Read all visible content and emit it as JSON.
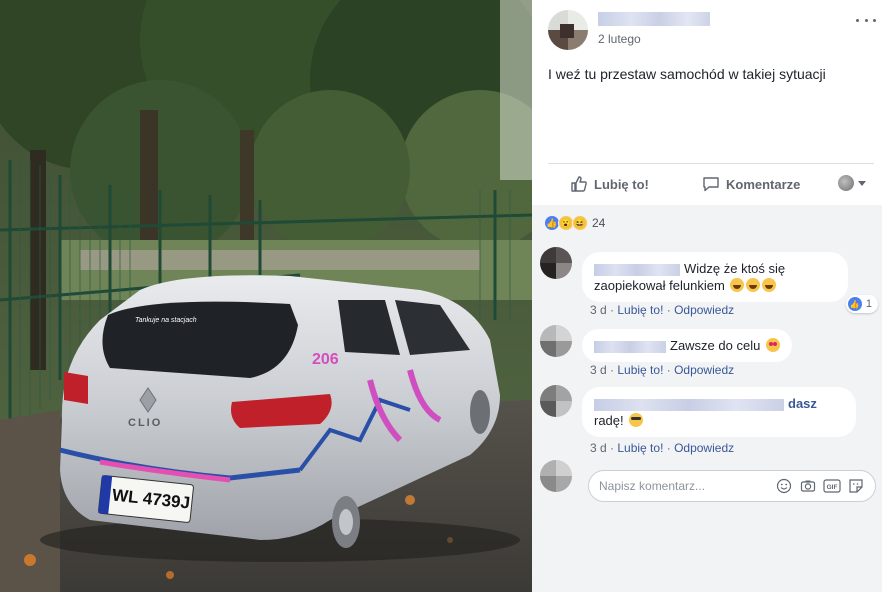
{
  "post": {
    "date": "2 lutego",
    "text": "I weź tu przestaw samochód w takiej sytuacji"
  },
  "photo": {
    "license_plate": "WL 4739J",
    "car_brand": "CLIO",
    "car_number": "206",
    "windshield_text": "Tankuje na stacjach"
  },
  "actions": {
    "like_label": "Lubię to!",
    "comment_label": "Komentarze"
  },
  "reactions": {
    "count": "24",
    "types": [
      "like-icon",
      "wow-icon",
      "haha-icon"
    ]
  },
  "comments": [
    {
      "text_a": "Widzę że ktoś się",
      "text_b": "zaopiekował felunkiem",
      "emoji": "😂😂😂",
      "time": "3 d",
      "like": "Lubię to!",
      "reply": "Odpowiedz",
      "likes": "1"
    },
    {
      "text": "Zawsze do celu",
      "emoji": "😍",
      "time": "3 d",
      "like": "Lubię to!",
      "reply": "Odpowiedz"
    },
    {
      "name_tail": "dasz",
      "text": "radę!",
      "emoji": "😎",
      "time": "3 d",
      "like": "Lubię to!",
      "reply": "Odpowiedz"
    }
  ],
  "write_comment": {
    "placeholder": "Napisz komentarz...",
    "icons": [
      "emoji-icon",
      "camera-icon",
      "gif-icon",
      "sticker-icon"
    ],
    "gif_label": "GIF"
  },
  "colors": {
    "link": "#385898",
    "meta": "#606770",
    "comments_bg": "#f2f3f5",
    "like_blue": "#4a7ef2"
  }
}
